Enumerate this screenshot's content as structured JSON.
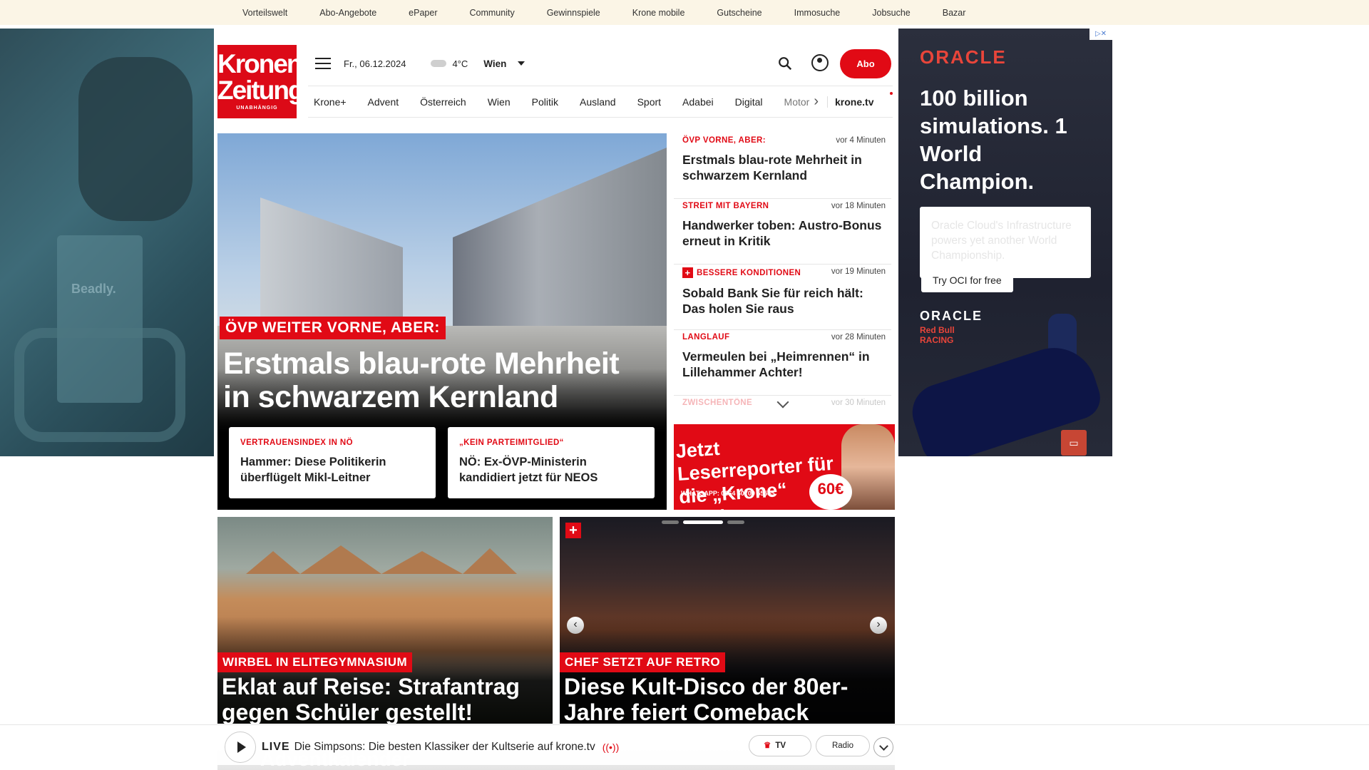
{
  "topbar": {
    "links": [
      "Vorteilswelt",
      "Abo-Angebote",
      "ePaper",
      "Community",
      "Gewinnspiele",
      "Krone mobile",
      "Gutscheine",
      "Immosuche",
      "Jobsuche",
      "Bazar"
    ]
  },
  "left_ad": {
    "brand": "Beadly."
  },
  "right_ad": {
    "logo": "ORACLE",
    "headline": "100 billion simulations. 1 World Champion.",
    "body": "Oracle Cloud's Infrastructure powers yet another World Championship.",
    "cta": "Try OCI for free",
    "logo2": "ORACLE",
    "partner": "Red Bull RACING"
  },
  "logo": {
    "line1": "Kronen",
    "line2": "Zeitung",
    "tagline": "UNABHÄNGIG"
  },
  "header": {
    "date": "Fr., 06.12.2024",
    "temperature": "4°C",
    "city": "Wien",
    "abo_label": "Abo"
  },
  "nav": {
    "items": [
      "Krone+",
      "Advent",
      "Österreich",
      "Wien",
      "Politik",
      "Ausland",
      "Sport",
      "Adabei",
      "Digital"
    ],
    "faded": "Motor",
    "tv": "krone.tv"
  },
  "hero": {
    "kicker": "ÖVP WEITER VORNE, ABER:",
    "title": "Erstmals blau-rote Mehrheit in schwarzem Kernland",
    "subs": [
      {
        "kicker": "VERTRAUENSINDEX IN NÖ",
        "title": "Hammer: Diese Politikerin überflügelt Mikl-Leitner"
      },
      {
        "kicker": "„KEIN PARTEIMITGLIED“",
        "title": "NÖ: Ex-ÖVP-Ministerin kandidiert jetzt für NEOS"
      }
    ]
  },
  "sidebar": {
    "items": [
      {
        "kicker": "ÖVP VORNE, ABER:",
        "time": "vor 4 Minuten",
        "title": "Erstmals blau-rote Mehrheit in schwarzem Kernland"
      },
      {
        "kicker": "STREIT MIT BAYERN",
        "time": "vor 18 Minuten",
        "title": "Handwerker toben: Austro-Bonus erneut in Kritik"
      },
      {
        "kicker": "BESSERE KONDITIONEN",
        "time": "vor 19 Minuten",
        "title": "Sobald Bank Sie für reich hält: Das holen Sie raus"
      },
      {
        "kicker": "LANGLAUF",
        "time": "vor 28 Minuten",
        "title": "Vermeulen bei „Heimrennen“ in Lillehammer Achter!"
      },
      {
        "kicker": "ZWISCHENTÖNE",
        "time": "vor 30 Minuten"
      }
    ]
  },
  "reporter_ad": {
    "title": "Jetzt Leserreporter für die „Krone“ werden",
    "whatsapp": "WHATSAPP: 0664 60700 55555",
    "amount": "60€"
  },
  "cards": [
    {
      "kicker": "WIRBEL IN ELITEGYMNASIUM",
      "title": "Eklat auf Reise: Strafantrag gegen Schüler gestellt!"
    },
    {
      "kicker": "CHEF SETZT AUF RETRO",
      "title": "Diese Kult-Disco der 80er-Jahre feiert Comeback"
    }
  ],
  "player": {
    "live_label": "LIVE",
    "text": "Die Simpsons: Die besten Klassiker der Kultserie auf krone.tv",
    "tab_tv": "TV",
    "tab_radio": "Radio",
    "under": "Adventkalender"
  }
}
